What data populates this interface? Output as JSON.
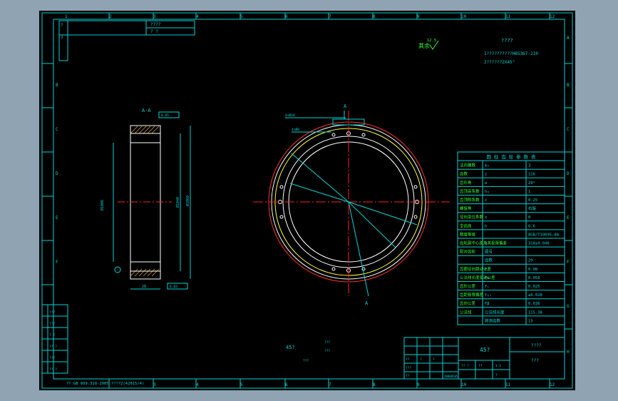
{
  "border": {
    "top_zones": [
      "1",
      "2",
      "3",
      "4",
      "5",
      "6",
      "7",
      "8",
      "9",
      "10",
      "11",
      "12"
    ],
    "bottom_zones": [
      "1",
      "2",
      "3",
      "4",
      "5",
      "6",
      "7",
      "8",
      "9",
      "10",
      "11",
      "12"
    ],
    "right_rows": [
      "A",
      "B",
      "C",
      "D",
      "E",
      "F",
      "G",
      "H"
    ],
    "left_rows": [
      "A",
      "B",
      "C",
      "D",
      "E",
      "F",
      "G",
      "H"
    ]
  },
  "stamp_top_left": {
    "mark": "?",
    "cells": [
      "????",
      "? ?"
    ]
  },
  "roughness_note": {
    "value": "12.5",
    "label": "其余"
  },
  "tech_requirements": {
    "title": "????",
    "line1": "1??????????HB5367-210",
    "line2": "2??????2X45°"
  },
  "section_view": {
    "label": "A-A",
    "dims": {
      "left_diameter": "Ø1006",
      "inner_dim": "Ø1040",
      "outer_dim": "Ø1060",
      "width": "28",
      "tolerance_top": "0.05",
      "tolerance_bottom": "0.03"
    }
  },
  "front_view": {
    "section_mark": "A",
    "hole_note_1": "4×Ø18",
    "hole_note_2": "4×Ø8",
    "dim_radius_1": "R",
    "dim_radius_2": "Ø",
    "section_mark_bottom": "A"
  },
  "gear_table": {
    "title": "圆 柱 齿 轮 参 数 表",
    "rows": [
      {
        "name": "法向模数",
        "sym": "mₙ",
        "val": "3"
      },
      {
        "name": "齿数",
        "sym": "z",
        "val": "116"
      },
      {
        "name": "齿形角",
        "sym": "α",
        "val": "20°"
      },
      {
        "name": "齿顶高系数",
        "sym": "hₐ",
        "val": "1"
      },
      {
        "name": "齿顶隙系数",
        "sym": "c",
        "val": "0.25"
      },
      {
        "name": "螺旋角",
        "sym": "",
        "val": "右旋"
      },
      {
        "name": "径向变位系数",
        "sym": "x",
        "val": "0"
      },
      {
        "name": "全齿高",
        "sym": "h",
        "val": "6.6"
      },
      {
        "name": "精度等级",
        "sym": "",
        "val": "8GB/T10095-88"
      },
      {
        "name": "齿轮副中心距及其极限偏差",
        "sym": "a",
        "val": "318±0.046"
      },
      {
        "name": "配对齿轮",
        "sym": "图号",
        "val": ""
      },
      {
        "name": "",
        "sym": "齿数",
        "val": "29"
      },
      {
        "name": "齿圈径向跳动公差",
        "sym": "Fᵣ",
        "val": "0.08"
      },
      {
        "name": "公法线长度变动公差",
        "sym": "Fw",
        "val": "0.056"
      },
      {
        "name": "齿形公差",
        "sym": "fᵢ",
        "val": "0.025"
      },
      {
        "name": "齿距极限偏差",
        "sym": "fₚₜ",
        "val": "±0.028"
      },
      {
        "name": "齿向公差",
        "sym": "Fβ",
        "val": "0.036"
      },
      {
        "name": "公法线",
        "sym": "公法线长度",
        "val": "115.38"
      },
      {
        "name": "",
        "sym": "跨测齿数",
        "val": "13"
      }
    ]
  },
  "title_block": {
    "material": "45?",
    "drawing_name": "????",
    "drawing_code": "???",
    "row_labels": [
      "??",
      "???",
      "??",
      "?",
      "?"
    ],
    "small_cells": [
      "?? ?",
      "??",
      "1:1",
      "?"
    ],
    "date": "20080505"
  },
  "left_strip": {
    "labels": [
      "???",
      "???",
      "? ?",
      "?? ?",
      "???",
      "?? ?"
    ]
  },
  "center_notes": {
    "material_note": "45?",
    "small_a": "???",
    "small_b": "???",
    "small_c": "???"
  },
  "bottom_note": "??:GB 609.310-2005 ????2(42015/4)"
}
